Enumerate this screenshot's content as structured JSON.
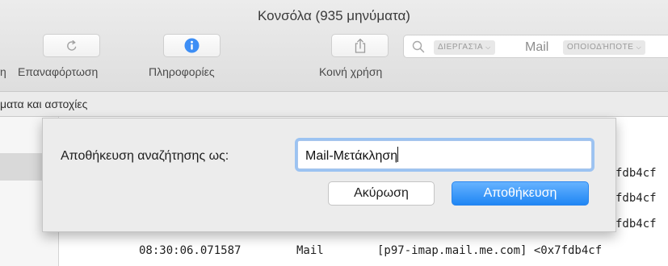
{
  "window": {
    "title": "Κονσόλα (935 μηνύματα)"
  },
  "toolbar": {
    "left_clip_label": "η",
    "reload_label": "Επαναφόρτωση",
    "info_label": "Πληροφορίες",
    "share_label": "Κοινή χρήση",
    "accent": "#3d8ef5"
  },
  "search": {
    "token_process": "ΔΙΕΡΓΑΣΊΑ",
    "token_value": "Mail",
    "token_any": "ΟΠΟΙΟΔΉΠΟΤΕ"
  },
  "section": {
    "label": "ματα και αστοχίες"
  },
  "log": {
    "fragments": [
      "fdb4cf",
      "fdb4cf",
      "fdb4cf"
    ],
    "row": {
      "time": "08:30:06.071587",
      "process": "Mail",
      "message": "[p97-imap.mail.me.com] <0x7fdb4cf"
    }
  },
  "dialog": {
    "label": "Αποθήκευση αναζήτησης ως:",
    "input_value": "Mail-Μετάκληση",
    "cancel_label": "Ακύρωση",
    "save_label": "Αποθήκευση"
  }
}
